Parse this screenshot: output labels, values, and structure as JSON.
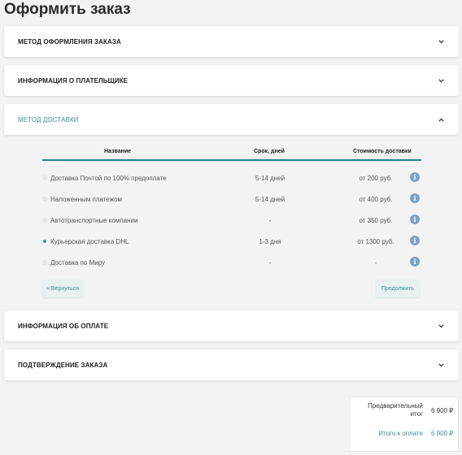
{
  "page": {
    "title": "Оформить заказ"
  },
  "sections": {
    "order_method": "МЕТОД ОФОРМЛЕНИЯ ЗАКАЗА",
    "payer_info": "ИНФОРМАЦИЯ О ПЛАТЕЛЬЩИКЕ",
    "delivery_method": "МЕТОД ДОСТАВКИ",
    "payment_info": "ИНФОРМАЦИЯ ОБ ОПЛАТЕ",
    "confirmation": "ПОДТВЕРЖДЕНИЕ ЗАКАЗА"
  },
  "delivery_table": {
    "columns": [
      "Название",
      "Срок, дней",
      "Стоимость доставки"
    ],
    "rows": [
      {
        "name": "Доставка Почтой по 100% предоплате",
        "term": "5-14 дней",
        "price": "от 200 руб.",
        "selected": false
      },
      {
        "name": "Наложенным платежом",
        "term": "5-14 дней",
        "price": "от 400 руб.",
        "selected": false
      },
      {
        "name": "Автотранспортные компании",
        "term": "-",
        "price": "от 350 руб.",
        "selected": false
      },
      {
        "name": "Курьерская доставка DHL",
        "term": "1-3 дня",
        "price": "от 1300 руб.",
        "selected": true
      },
      {
        "name": "Доставка по Миру",
        "term": "-",
        "price": "-",
        "selected": false
      }
    ]
  },
  "buttons": {
    "back": "« Вернуться",
    "next": "Продолжить"
  },
  "summary": {
    "subtotal_label": "Предварительный итог",
    "subtotal_value": "6 900 ₽",
    "total_label": "Итого к оплате",
    "total_value": "6 900 ₽"
  },
  "colors": {
    "accent": "#3a8d97",
    "info_icon": "#7fa0c9",
    "background": "#f3f3f3"
  },
  "icons": {
    "collapsed": "chevron-down-icon",
    "expanded": "chevron-up-icon",
    "info": "info-icon"
  }
}
